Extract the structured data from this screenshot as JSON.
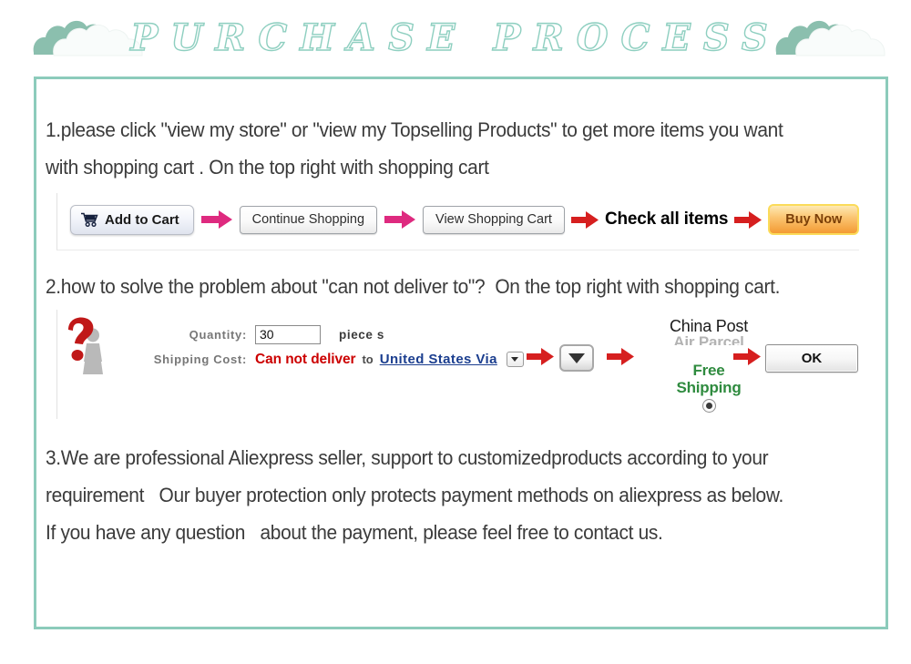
{
  "header": {
    "title": "PURCHASE PROCESS",
    "accent_color": "#8ccbbb",
    "cloud_color": "#8bbfae",
    "cloud_front_color": "#fbfdfc"
  },
  "steps": [
    {
      "id": "step-1",
      "text": "1.please click \"view my store\" or \"view my Topselling Products\" to get more items you want\nwith shopping cart . On the top right with shopping cart"
    },
    {
      "id": "step-2",
      "text": "2.how to solve the problem about \"can not deliver to\"?  On the top right with shopping cart."
    },
    {
      "id": "step-3",
      "text": "3.We are professional Aliexpress seller, support to customizedproducts according to your\nrequirement   Our buyer protection only protects payment methods on aliexpress as below.\nIf you have any question   about the payment, please feel free to contact us."
    }
  ],
  "cart_flow": {
    "add_to_cart_label": "Add to Cart",
    "cart_icon": "shopping-cart-icon",
    "continue_shopping_label": "Continue Shopping",
    "view_cart_label": "View Shopping Cart",
    "check_all_items_label": "Check all items",
    "buy_now_label": "Buy Now",
    "arrow_pink_color": "#de2a7f",
    "arrow_red_color": "#d61f1f",
    "buy_now_border_color": "#fbdb5a",
    "buy_now_text_color": "#7a3f08"
  },
  "shipping_form": {
    "question_icon": "question-mark-icon",
    "quantity_label": "Quantity:",
    "quantity_value": "30",
    "quantity_unit": "piece s",
    "shipping_cost_label": "Shipping Cost:",
    "cannot_deliver_text": "Can not deliver",
    "to_text": "to",
    "country_link": "United States Via",
    "country_caret_icon": "chevron-down-icon",
    "method_caret_icon": "chevron-down-icon",
    "carrier_name": "China Post",
    "carrier_service": "Air Parcel",
    "free_shipping_line1": "Free",
    "free_shipping_line2": "Shipping",
    "free_shipping_color": "#2f8b3f",
    "radio_icon": "radio-selected-icon",
    "ok_label": "OK",
    "cannot_deliver_color": "#cc0000",
    "country_link_color": "#1b3e8f"
  }
}
